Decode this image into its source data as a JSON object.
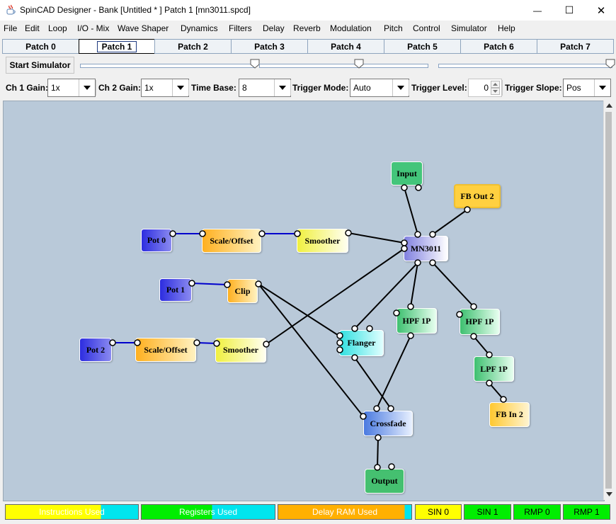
{
  "window": {
    "title": "SpinCAD Designer - Bank [Untitled * ] Patch 1 [mn3011.spcd]",
    "minimize_glyph": "—",
    "maximize_glyph": "☐",
    "close_glyph": "✕"
  },
  "menu": [
    "File",
    "Edit",
    "Loop",
    "I/O - Mix",
    "Wave Shaper",
    "Dynamics",
    "Filters",
    "Delay",
    "Reverb",
    "Modulation",
    "Pitch",
    "Control",
    "Simulator",
    "Help"
  ],
  "tabs": [
    "Patch 0",
    "Patch 1",
    "Patch 2",
    "Patch 3",
    "Patch 4",
    "Patch 5",
    "Patch 6",
    "Patch 7"
  ],
  "active_tab": "Patch 1",
  "simulator": {
    "start_label": "Start Simulator",
    "slider_levels": [
      1.0,
      0.59,
      0.99
    ]
  },
  "scope": {
    "ch1_gain_label": "Ch 1 Gain:",
    "ch1_gain": "1x",
    "ch2_gain_label": "Ch 2 Gain:",
    "ch2_gain": "1x",
    "time_base_label": "Time Base:",
    "time_base": "8",
    "trigger_mode_label": "Trigger Mode:",
    "trigger_mode": "Auto",
    "trigger_level_label": "Trigger Level:",
    "trigger_level": "0",
    "trigger_slope_label": "Trigger Slope:",
    "trigger_slope": "Pos"
  },
  "blocks": {
    "input": "Input",
    "fb_out_2": "FB Out 2",
    "pot0": "Pot 0",
    "scale_offset_1": "Scale/Offset",
    "smoother_1": "Smoother",
    "mn3011": "MN3011",
    "pot1": "Pot 1",
    "clip": "Clip",
    "hpf_1": "HPF 1P",
    "hpf_2": "HPF 1P",
    "pot2": "Pot 2",
    "scale_offset_2": "Scale/Offset",
    "smoother_2": "Smoother",
    "flanger": "Flanger",
    "lpf": "LPF 1P",
    "fb_in_2": "FB In 2",
    "crossfade": "Crossfade",
    "output": "Output"
  },
  "status": {
    "instructions": "Instructions Used",
    "registers": "Registers Used",
    "delay_ram": "Delay RAM Used",
    "sin0": "SIN 0",
    "sin1": "SIN 1",
    "rmp0": "RMP 0",
    "rmp1": "RMP 1"
  },
  "colors": {
    "canvas": "#b9c9d9",
    "wire": "#000000",
    "control_wire": "#0000cc",
    "status_yellow": "#ffff00",
    "status_cyan": "#00e5ee",
    "status_green": "#00ee00",
    "status_orange": "#ffb000"
  }
}
